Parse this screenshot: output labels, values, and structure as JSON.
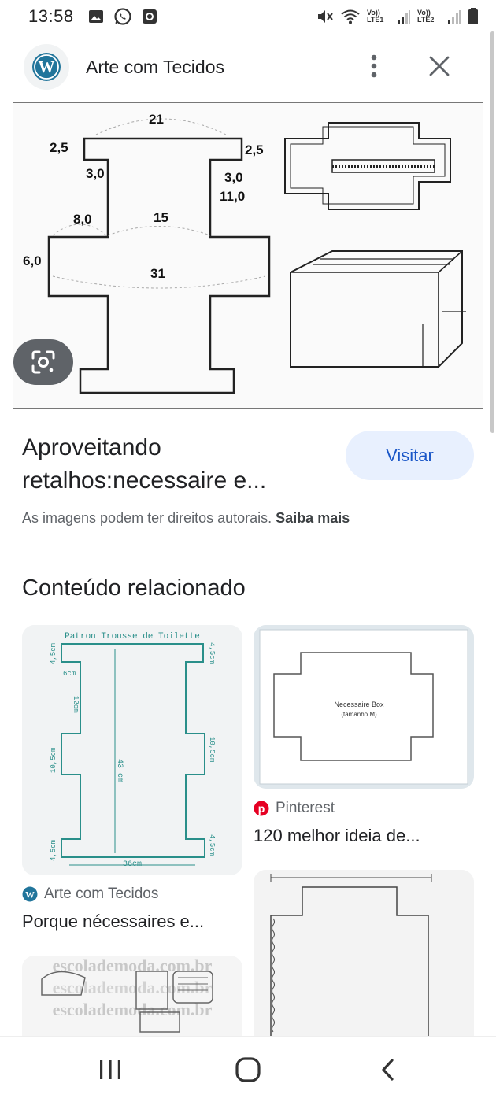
{
  "status": {
    "time": "13:58",
    "sim1": "Vo)) LTE1",
    "sim2": "Vo)) LTE2",
    "icons": [
      "image-icon",
      "whatsapp-icon",
      "screen-record-icon",
      "mute-icon",
      "wifi-icon",
      "signal-icon",
      "battery-icon"
    ]
  },
  "header": {
    "site_name": "Arte com Tecidos",
    "logo_icon": "wordpress-logo",
    "menu_icon": "more-vert-icon",
    "close_icon": "close-icon"
  },
  "main_image": {
    "labels": {
      "top": "21",
      "left_corner": "2,5",
      "right_corner": "2,5",
      "left_neck": "3,0",
      "right_neck": "3,0",
      "right_height": "11,0",
      "left_shoulder": "8,0",
      "center": "15",
      "side": "6,0",
      "width": "31"
    },
    "lens_icon": "google-lens-icon"
  },
  "result": {
    "title_line1": "Aproveitando",
    "title_line2": "retalhos:necessaire e...",
    "visit_label": "Visitar",
    "copyright_text": "As imagens podem ter direitos autorais.",
    "learn_more": "Saiba mais"
  },
  "related": {
    "heading": "Conteúdo relacionado",
    "cards": [
      {
        "source": "Arte com Tecidos",
        "title": "Porque nécessaires e...",
        "image_text": {
          "title": "Patron Trousse de Toilette",
          "length": "43 cm",
          "width": "36cm",
          "l_top": "4,5cm",
          "l_mid": "10,5cm",
          "l_bot": "4,5cm",
          "r_top": "4,5cm",
          "r_mid": "10,5cm",
          "r_bot": "4,5cm",
          "six": "6cm",
          "twelve": "12cm"
        }
      },
      {
        "source": "Pinterest",
        "title": "120 melhor ideia de...",
        "image_text": {
          "name": "Necessaire Box",
          "size": "(tamanho M)"
        }
      },
      {
        "source": "",
        "title": "",
        "image_text": {
          "watermark": "escolademoda.com.br"
        }
      },
      {
        "source": "",
        "title": "",
        "image_text": {}
      }
    ]
  },
  "nav": {
    "recent_icon": "recent-apps-icon",
    "home_icon": "home-icon",
    "back_icon": "back-icon"
  },
  "colors": {
    "visit_bg": "#e8f0fe",
    "visit_text": "#1a57c8",
    "wordpress": "#21759b",
    "pinterest": "#e60023",
    "pattern_teal": "#2a8f8a"
  }
}
